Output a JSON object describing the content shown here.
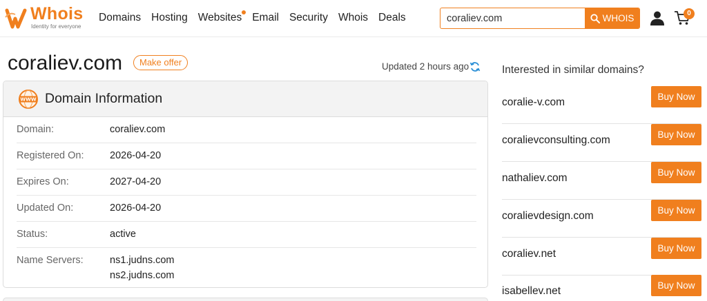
{
  "header": {
    "logo_text": "Whois",
    "logo_tagline": "Identity for everyone",
    "nav": [
      "Domains",
      "Hosting",
      "Websites",
      "Email",
      "Security",
      "Whois",
      "Deals"
    ],
    "search_value": "coraliev.com",
    "search_button": "WHOIS",
    "cart_count": "0",
    "accent_color": "#f07f1e"
  },
  "title": {
    "domain": "coraliev.com",
    "make_offer": "Make offer",
    "updated": "Updated 2 hours ago"
  },
  "domain_info": {
    "heading": "Domain Information",
    "rows": [
      {
        "label": "Domain:",
        "value": "coraliev.com"
      },
      {
        "label": "Registered On:",
        "value": "2026-04-20"
      },
      {
        "label": "Expires On:",
        "value": "2027-04-20"
      },
      {
        "label": "Updated On:",
        "value": "2026-04-20"
      },
      {
        "label": "Status:",
        "value": "active"
      },
      {
        "label": "Name Servers:",
        "value": "ns1.judns.com",
        "value2": "ns2.judns.com"
      }
    ]
  },
  "similar": {
    "heading": "Interested in similar domains?",
    "buy_label": "Buy Now",
    "domains": [
      "coralie-v.com",
      "coralievconsulting.com",
      "nathaliev.com",
      "coralievdesign.com",
      "coraliev.net",
      "isabellev.net"
    ]
  }
}
